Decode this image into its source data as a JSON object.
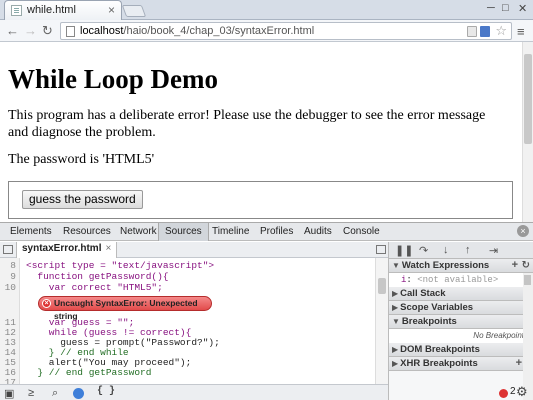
{
  "browser": {
    "tab_title": "while.html",
    "tab_close": "×",
    "window_buttons": {
      "minimize": "─",
      "maximize": "□",
      "close": "✕"
    },
    "nav": {
      "back": "←",
      "forward": "→",
      "reload": "↻"
    },
    "url_host": "localhost",
    "url_path": "/haio/book_4/chap_03/syntaxError.html",
    "star": "☆",
    "menu": "≡"
  },
  "page": {
    "title": "While Loop Demo",
    "paragraph": "This program has a deliberate error! Please use the debugger to see the error message and diagnose the problem.",
    "password_line": "The password is 'HTML5'",
    "button_label": "guess the password"
  },
  "devtools": {
    "tabs": [
      "Elements",
      "Resources",
      "Network",
      "Sources",
      "Timeline",
      "Profiles",
      "Audits",
      "Console"
    ],
    "active_tab": "Sources",
    "close": "×",
    "file_tab": "syntaxError.html",
    "file_tab_close": "×",
    "code_lines": [
      {
        "n": "8",
        "text": "<script type = \"text/javascript\">"
      },
      {
        "n": "9",
        "text": "  function getPassword(){"
      },
      {
        "n": "10",
        "text": "    var correct \"HTML5\";"
      },
      {
        "n": "11",
        "text": "    var guess = \"\";"
      },
      {
        "n": "12",
        "text": "    while (guess != correct){"
      },
      {
        "n": "13",
        "text": "      guess = prompt(\"Password?\");"
      },
      {
        "n": "14",
        "text": "    } // end while"
      },
      {
        "n": "15",
        "text": "    alert(\"You may proceed\");"
      },
      {
        "n": "16",
        "text": "  } // end getPassword"
      },
      {
        "n": "17",
        "text": ""
      }
    ],
    "error_message": "Uncaught SyntaxError: Unexpected string",
    "error_icon": "×",
    "pretty_print": "{ }",
    "error_count": "2",
    "gear": "⚙"
  },
  "debug_panel": {
    "sections": [
      {
        "label": "Watch Expressions",
        "expanded": true
      },
      {
        "label": "Call Stack",
        "expanded": false
      },
      {
        "label": "Scope Variables",
        "expanded": false
      },
      {
        "label": "Breakpoints",
        "expanded": true
      },
      {
        "label": "DOM Breakpoints",
        "expanded": false
      },
      {
        "label": "XHR Breakpoints",
        "expanded": false
      }
    ],
    "watch_name": "i",
    "watch_value": "<not available>",
    "no_breakpoints": "No Breakpoints",
    "add": "+",
    "refresh": "↻"
  },
  "colors": {
    "error_bubble": "#e24b4b",
    "active_tab": "#d2d6db",
    "pause_blue": "#3f7fd9"
  }
}
